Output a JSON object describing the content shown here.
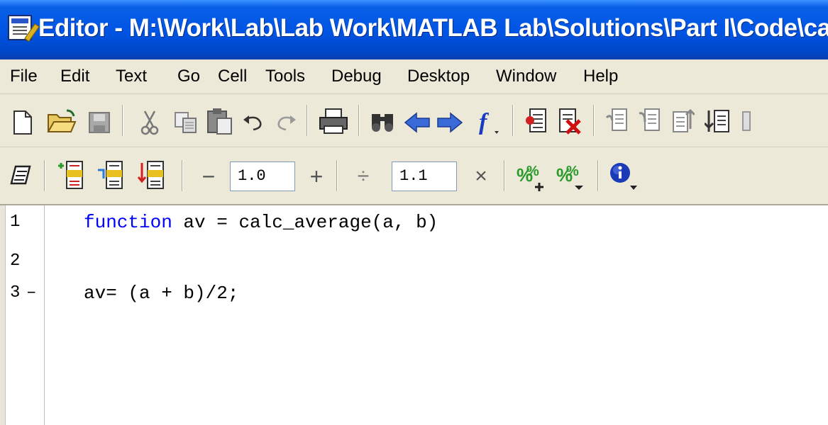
{
  "window": {
    "title": "Editor - M:\\Work\\Lab\\Lab Work\\MATLAB Lab\\Solutions\\Part I\\Code\\calc_av"
  },
  "menu": {
    "items": [
      "File",
      "Edit",
      "Text",
      "Go",
      "Cell",
      "Tools",
      "Debug",
      "Desktop",
      "Window",
      "Help"
    ]
  },
  "toolbar": {
    "icons": [
      "new-file-icon",
      "open-folder-icon",
      "save-icon",
      "cut-icon",
      "copy-icon",
      "paste-icon",
      "undo-icon",
      "redo-icon",
      "print-icon",
      "find-icon",
      "back-icon",
      "forward-icon",
      "function-icon",
      "set-breakpoint-icon",
      "clear-breakpoints-icon",
      "step-icon",
      "step-in-icon",
      "step-out-icon",
      "continue-icon"
    ]
  },
  "cell_toolbar": {
    "minus_label": "−",
    "value1": "1.0",
    "plus_label": "+",
    "divide_label": "÷",
    "value2": "1.1",
    "times_label": "×"
  },
  "editor": {
    "lines": [
      {
        "number": "1",
        "keyword": "function",
        "rest": " av = calc_average(a, b)",
        "breakpoint_dash": ""
      },
      {
        "number": "2",
        "keyword": "",
        "rest": "",
        "breakpoint_dash": ""
      },
      {
        "number": "3",
        "keyword": "",
        "rest": "av= (a + b)/2;",
        "breakpoint_dash": "–"
      }
    ]
  },
  "colors": {
    "title_bar": "#0055e5",
    "chrome": "#ece9d8",
    "keyword": "#0000ff"
  }
}
